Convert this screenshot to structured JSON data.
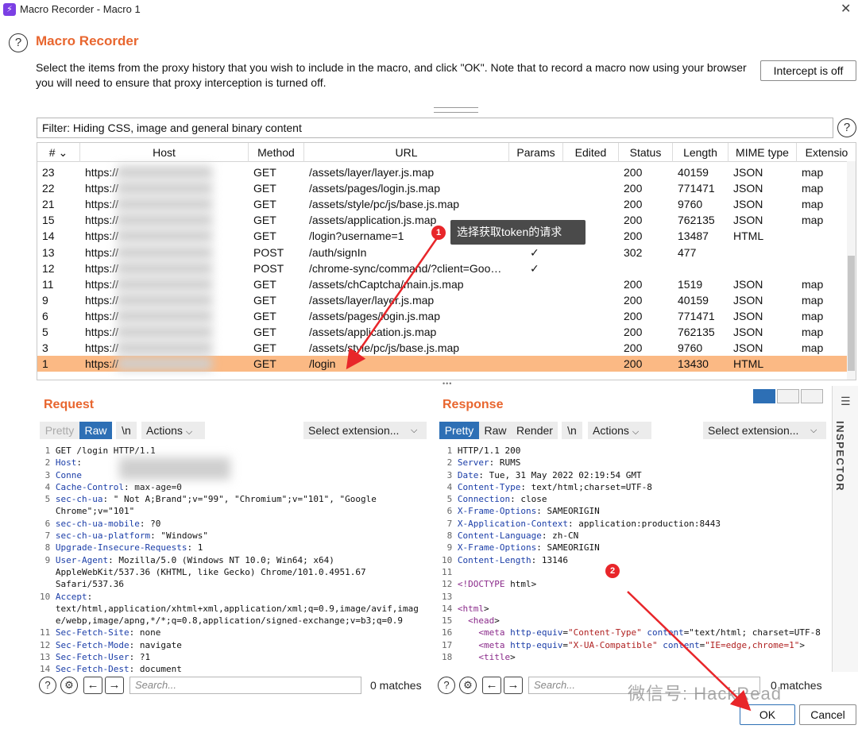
{
  "window": {
    "title": "Macro Recorder - Macro 1",
    "icon_glyph": "⚡",
    "close_glyph": "✕"
  },
  "header": {
    "heading": "Macro Recorder",
    "instructions": "Select the items from the proxy history that you wish to include in the macro, and click \"OK\". Note that to record a macro now using your browser you will need to ensure that proxy interception is turned off.",
    "intercept_label": "Intercept is off"
  },
  "filter": {
    "text": "Filter: Hiding CSS, image and general binary content"
  },
  "table": {
    "columns": [
      "#",
      "Host",
      "Method",
      "URL",
      "Params",
      "Edited",
      "Status",
      "Length",
      "MIME type",
      "Extensio"
    ],
    "rows": [
      {
        "num": "23",
        "host": "https://",
        "method": "GET",
        "url": "/assets/layer/layer.js.map",
        "params": "",
        "edited": "",
        "status": "200",
        "length": "40159",
        "mime": "JSON",
        "ext": "map"
      },
      {
        "num": "22",
        "host": "https://",
        "method": "GET",
        "url": "/assets/pages/login.js.map",
        "params": "",
        "edited": "",
        "status": "200",
        "length": "771471",
        "mime": "JSON",
        "ext": "map"
      },
      {
        "num": "21",
        "host": "https://",
        "method": "GET",
        "url": "/assets/style/pc/js/base.js.map",
        "params": "",
        "edited": "",
        "status": "200",
        "length": "9760",
        "mime": "JSON",
        "ext": "map"
      },
      {
        "num": "15",
        "host": "https://",
        "method": "GET",
        "url": "/assets/application.js.map",
        "params": "",
        "edited": "",
        "status": "200",
        "length": "762135",
        "mime": "JSON",
        "ext": "map"
      },
      {
        "num": "14",
        "host": "https://",
        "method": "GET",
        "url": "/login?username=1",
        "params": "✓",
        "edited": "",
        "status": "200",
        "length": "13487",
        "mime": "HTML",
        "ext": ""
      },
      {
        "num": "13",
        "host": "https://",
        "method": "POST",
        "url": "/auth/signIn",
        "params": "✓",
        "edited": "",
        "status": "302",
        "length": "477",
        "mime": "",
        "ext": ""
      },
      {
        "num": "12",
        "host": "https://",
        "method": "POST",
        "url": "/chrome-sync/command/?client=Goo…",
        "params": "✓",
        "edited": "",
        "status": "",
        "length": "",
        "mime": "",
        "ext": ""
      },
      {
        "num": "11",
        "host": "https://",
        "method": "GET",
        "url": "/assets/chCaptcha/main.js.map",
        "params": "",
        "edited": "",
        "status": "200",
        "length": "1519",
        "mime": "JSON",
        "ext": "map"
      },
      {
        "num": "9",
        "host": "https://",
        "method": "GET",
        "url": "/assets/layer/layer.js.map",
        "params": "",
        "edited": "",
        "status": "200",
        "length": "40159",
        "mime": "JSON",
        "ext": "map"
      },
      {
        "num": "6",
        "host": "https://",
        "method": "GET",
        "url": "/assets/pages/login.js.map",
        "params": "",
        "edited": "",
        "status": "200",
        "length": "771471",
        "mime": "JSON",
        "ext": "map"
      },
      {
        "num": "5",
        "host": "https://",
        "method": "GET",
        "url": "/assets/application.js.map",
        "params": "",
        "edited": "",
        "status": "200",
        "length": "762135",
        "mime": "JSON",
        "ext": "map"
      },
      {
        "num": "3",
        "host": "https://",
        "method": "GET",
        "url": "/assets/style/pc/js/base.js.map",
        "params": "",
        "edited": "",
        "status": "200",
        "length": "9760",
        "mime": "JSON",
        "ext": "map"
      },
      {
        "num": "1",
        "host": "https://",
        "method": "GET",
        "url": "/login",
        "params": "",
        "edited": "",
        "status": "200",
        "length": "13430",
        "mime": "HTML",
        "ext": "",
        "selected": true
      }
    ]
  },
  "annotation": {
    "tooltip": "选择获取token的请求",
    "badge1": "1",
    "badge2": "2"
  },
  "request": {
    "title": "Request",
    "tabs": [
      "Pretty",
      "Raw",
      "\\n"
    ],
    "active_tab": "Raw",
    "actions_label": "Actions",
    "extension_label": "Select extension...",
    "lines": [
      {
        "n": "1",
        "k": "",
        "v": "GET /login HTTP/1.1"
      },
      {
        "n": "2",
        "k": "Host",
        "v": ":"
      },
      {
        "n": "3",
        "k": "Conne",
        "v": ""
      },
      {
        "n": "4",
        "k": "Cache-Control",
        "v": ": max-age=0"
      },
      {
        "n": "5",
        "k": "sec-ch-ua",
        "v": ": \" Not A;Brand\";v=\"99\", \"Chromium\";v=\"101\", \"Google"
      },
      {
        "n": "",
        "k": "",
        "v": "Chrome\";v=\"101\""
      },
      {
        "n": "6",
        "k": "sec-ch-ua-mobile",
        "v": ": ?0"
      },
      {
        "n": "7",
        "k": "sec-ch-ua-platform",
        "v": ": \"Windows\""
      },
      {
        "n": "8",
        "k": "Upgrade-Insecure-Requests",
        "v": ": 1"
      },
      {
        "n": "9",
        "k": "User-Agent",
        "v": ": Mozilla/5.0 (Windows NT 10.0; Win64; x64)"
      },
      {
        "n": "",
        "k": "",
        "v": "AppleWebKit/537.36 (KHTML, like Gecko) Chrome/101.0.4951.67"
      },
      {
        "n": "",
        "k": "",
        "v": "Safari/537.36"
      },
      {
        "n": "10",
        "k": "Accept",
        "v": ":"
      },
      {
        "n": "",
        "k": "",
        "v": "text/html,application/xhtml+xml,application/xml;q=0.9,image/avif,imag"
      },
      {
        "n": "",
        "k": "",
        "v": "e/webp,image/apng,*/*;q=0.8,application/signed-exchange;v=b3;q=0.9"
      },
      {
        "n": "11",
        "k": "Sec-Fetch-Site",
        "v": ": none"
      },
      {
        "n": "12",
        "k": "Sec-Fetch-Mode",
        "v": ": navigate"
      },
      {
        "n": "13",
        "k": "Sec-Fetch-User",
        "v": ": ?1"
      },
      {
        "n": "14",
        "k": "Sec-Fetch-Dest",
        "v": ": document"
      }
    ],
    "search_placeholder": "Search...",
    "matches": "0 matches"
  },
  "response": {
    "title": "Response",
    "tabs": [
      "Pretty",
      "Raw",
      "Render",
      "\\n"
    ],
    "active_tab": "Pretty",
    "actions_label": "Actions",
    "extension_label": "Select extension...",
    "lines": [
      {
        "n": "1",
        "k": "",
        "v": "HTTP/1.1 200"
      },
      {
        "n": "2",
        "k": "Server",
        "v": ": RUMS"
      },
      {
        "n": "3",
        "k": "Date",
        "v": ": Tue, 31 May 2022 02:19:54 GMT"
      },
      {
        "n": "4",
        "k": "Content-Type",
        "v": ": text/html;charset=UTF-8"
      },
      {
        "n": "5",
        "k": "Connection",
        "v": ": close"
      },
      {
        "n": "6",
        "k": "X-Frame-Options",
        "v": ": SAMEORIGIN"
      },
      {
        "n": "7",
        "k": "X-Application-Context",
        "v": ": application:production:8443"
      },
      {
        "n": "8",
        "k": "Content-Language",
        "v": ": zh-CN"
      },
      {
        "n": "9",
        "k": "X-Frame-Options",
        "v": ": SAMEORIGIN"
      },
      {
        "n": "10",
        "k": "Content-Length",
        "v": ": 13146"
      },
      {
        "n": "11",
        "k": "",
        "v": ""
      },
      {
        "n": "12",
        "k": "",
        "v": "<!DOCTYPE html>"
      },
      {
        "n": "13",
        "k": "",
        "v": ""
      },
      {
        "n": "14",
        "k": "",
        "v": "<html>"
      },
      {
        "n": "15",
        "k": "",
        "v": "  <head>"
      },
      {
        "n": "16",
        "k": "",
        "v": "    <meta http-equiv=\"Content-Type\" content=\"text/html; charset=UTF-8"
      },
      {
        "n": "17",
        "k": "",
        "v": "    <meta http-equiv=\"X-UA-Compatible\" content=\"IE=edge,chrome=1\">"
      },
      {
        "n": "18",
        "k": "",
        "v": "    <title>"
      }
    ],
    "search_placeholder": "Search...",
    "matches": "0 matches"
  },
  "inspector": {
    "label": "INSPECTOR",
    "menu_glyph": "☰"
  },
  "icons": {
    "help": "?",
    "gear": "⚙",
    "prev": "←",
    "next": "→",
    "chevron": "⌄",
    "sort": "⌄"
  },
  "footer": {
    "ok": "OK",
    "cancel": "Cancel"
  },
  "watermark": "微信号: HackRead",
  "colors": {
    "accent_orange": "#e8662f",
    "selected_row": "#fbb984",
    "tab_blue": "#2d6fb5",
    "annotation_red": "#e8262a"
  }
}
